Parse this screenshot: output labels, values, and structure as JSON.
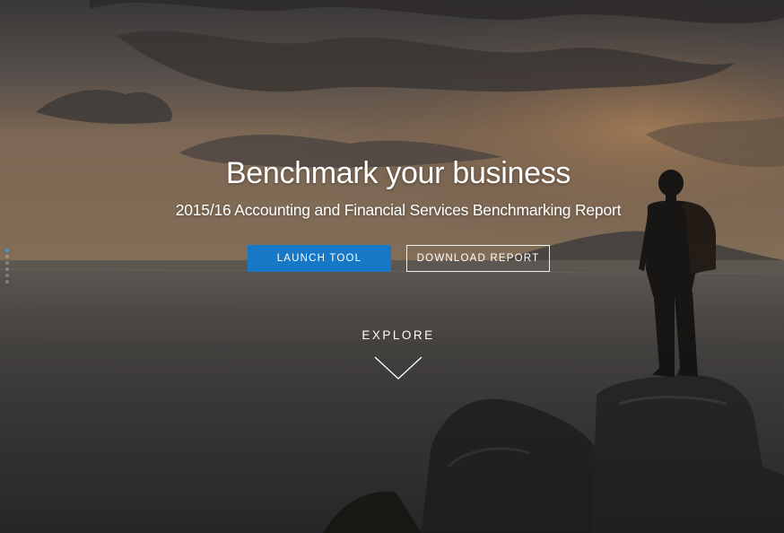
{
  "hero": {
    "title": "Benchmark your business",
    "subtitle": "2015/16 Accounting and Financial Services Benchmarking Report",
    "image_description": "hiker-on-rock-overlooking-sea-at-sunset"
  },
  "buttons": {
    "launch_label": "LAUNCH TOOL",
    "download_label": "DOWNLOAD REPORT"
  },
  "explore": {
    "label": "EXPLORE",
    "icon": "chevron-down-icon"
  },
  "pager": {
    "count": 6,
    "active_index": 0
  },
  "colors": {
    "accent": "#1878c8",
    "active_dot": "#3a9ee0",
    "text": "#ffffff"
  }
}
